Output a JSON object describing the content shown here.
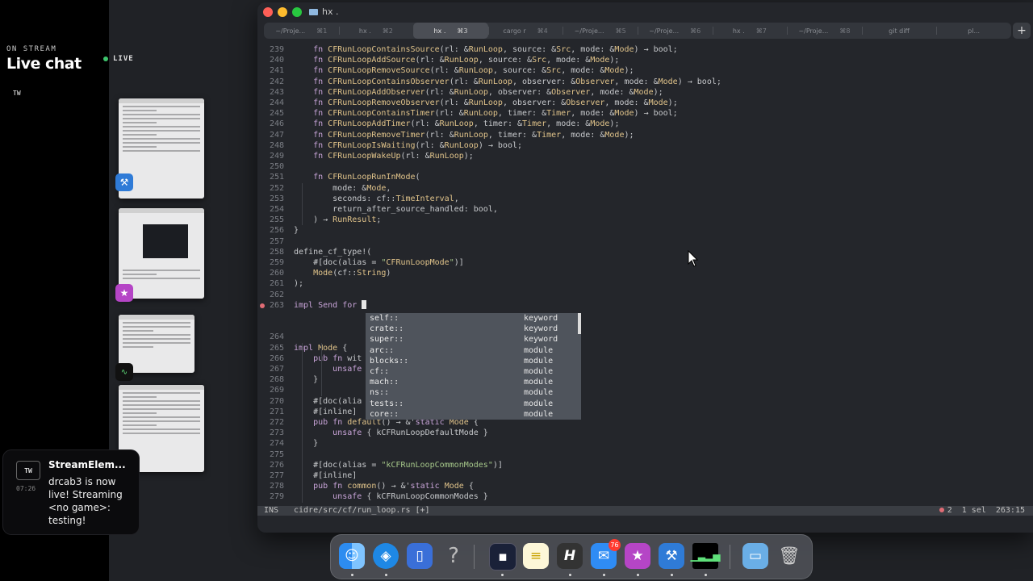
{
  "chat": {
    "on_stream_label": "ON STREAM",
    "title": "Live chat",
    "platform_tag": "TW",
    "live_label": "LIVE"
  },
  "notification": {
    "platform": "TW",
    "time": "07:26",
    "title": "StreamElem...",
    "body": "drcab3 is now live! Streaming <no game>: testing!"
  },
  "window": {
    "title": "hx .",
    "tabs": [
      {
        "label": "~/Proje...",
        "shortcut": "⌘1",
        "active": false
      },
      {
        "label": "hx .",
        "shortcut": "⌘2",
        "active": false
      },
      {
        "label": "hx .",
        "shortcut": "⌘3",
        "active": true
      },
      {
        "label": "cargo r",
        "shortcut": "⌘4",
        "active": false
      },
      {
        "label": "~/Proje...",
        "shortcut": "⌘5",
        "active": false
      },
      {
        "label": "~/Proje...",
        "shortcut": "⌘6",
        "active": false
      },
      {
        "label": "hx .",
        "shortcut": "⌘7",
        "active": false
      },
      {
        "label": "~/Proje...",
        "shortcut": "⌘8",
        "active": false
      },
      {
        "label": "git diff",
        "shortcut": "",
        "active": false
      },
      {
        "label": "pl...",
        "shortcut": "",
        "active": false
      }
    ],
    "new_tab_label": "+"
  },
  "editor": {
    "lines": [
      {
        "n": "239",
        "text": "    fn CFRunLoopContainsSource(rl: &RunLoop, source: &Src, mode: &Mode) → bool;"
      },
      {
        "n": "240",
        "text": "    fn CFRunLoopAddSource(rl: &RunLoop, source: &Src, mode: &Mode);"
      },
      {
        "n": "241",
        "text": "    fn CFRunLoopRemoveSource(rl: &RunLoop, source: &Src, mode: &Mode);"
      },
      {
        "n": "242",
        "text": "    fn CFRunLoopContainsObserver(rl: &RunLoop, observer: &Observer, mode: &Mode) → bool;"
      },
      {
        "n": "243",
        "text": "    fn CFRunLoopAddObserver(rl: &RunLoop, observer: &Observer, mode: &Mode);"
      },
      {
        "n": "244",
        "text": "    fn CFRunLoopRemoveObserver(rl: &RunLoop, observer: &Observer, mode: &Mode);"
      },
      {
        "n": "245",
        "text": "    fn CFRunLoopContainsTimer(rl: &RunLoop, timer: &Timer, mode: &Mode) → bool;"
      },
      {
        "n": "246",
        "text": "    fn CFRunLoopAddTimer(rl: &RunLoop, timer: &Timer, mode: &Mode);"
      },
      {
        "n": "247",
        "text": "    fn CFRunLoopRemoveTimer(rl: &RunLoop, timer: &Timer, mode: &Mode);"
      },
      {
        "n": "248",
        "text": "    fn CFRunLoopIsWaiting(rl: &RunLoop) → bool;"
      },
      {
        "n": "249",
        "text": "    fn CFRunLoopWakeUp(rl: &RunLoop);"
      },
      {
        "n": "250",
        "text": ""
      },
      {
        "n": "251",
        "text": "    fn CFRunLoopRunInMode("
      },
      {
        "n": "252",
        "text": "        mode: &Mode,"
      },
      {
        "n": "253",
        "text": "        seconds: cf::TimeInterval,"
      },
      {
        "n": "254",
        "text": "        return_after_source_handled: bool,"
      },
      {
        "n": "255",
        "text": "    ) → RunResult;"
      },
      {
        "n": "256",
        "text": "}"
      },
      {
        "n": "257",
        "text": ""
      },
      {
        "n": "258",
        "text": "define_cf_type!("
      },
      {
        "n": "259",
        "text": "    #[doc(alias = \"CFRunLoopMode\")]"
      },
      {
        "n": "260",
        "text": "    Mode(cf::String)"
      },
      {
        "n": "261",
        "text": ");"
      },
      {
        "n": "262",
        "text": ""
      },
      {
        "n": "263",
        "text": "impl Send for "
      },
      {
        "n": "",
        "text": ""
      },
      {
        "n": "",
        "text": ""
      },
      {
        "n": "264",
        "text": ""
      },
      {
        "n": "265",
        "text": "impl Mode {"
      },
      {
        "n": "266",
        "text": "    pub fn wit"
      },
      {
        "n": "267",
        "text": "        unsafe"
      },
      {
        "n": "268",
        "text": "    }"
      },
      {
        "n": "269",
        "text": ""
      },
      {
        "n": "270",
        "text": "    #[doc(alia"
      },
      {
        "n": "271",
        "text": "    #[inline]"
      },
      {
        "n": "272",
        "text": "    pub fn default() → &'static Mode {"
      },
      {
        "n": "273",
        "text": "        unsafe { kCFRunLoopDefaultMode }"
      },
      {
        "n": "274",
        "text": "    }"
      },
      {
        "n": "275",
        "text": ""
      },
      {
        "n": "276",
        "text": "    #[doc(alias = \"kCFRunLoopCommonModes\")]"
      },
      {
        "n": "277",
        "text": "    #[inline]"
      },
      {
        "n": "278",
        "text": "    pub fn common() → &'static Mode {"
      },
      {
        "n": "279",
        "text": "        unsafe { kCFRunLoopCommonModes }"
      }
    ],
    "completion": [
      {
        "name": "self::",
        "kind": "keyword"
      },
      {
        "name": "crate::",
        "kind": "keyword"
      },
      {
        "name": "super::",
        "kind": "keyword"
      },
      {
        "name": "arc::",
        "kind": "module"
      },
      {
        "name": "blocks::",
        "kind": "module"
      },
      {
        "name": "cf::",
        "kind": "module"
      },
      {
        "name": "mach::",
        "kind": "module"
      },
      {
        "name": "ns::",
        "kind": "module"
      },
      {
        "name": "tests::",
        "kind": "module"
      },
      {
        "name": "core::",
        "kind": "module"
      }
    ]
  },
  "status": {
    "mode": "INS",
    "file": "cidre/src/cf/run_loop.rs [+]",
    "errors": "2",
    "selection": "1 sel",
    "position": "263:15"
  },
  "dock": {
    "mail_badge": "76",
    "help_glyph": "?"
  },
  "colors": {
    "live_green": "#3ec46d",
    "error_red": "#e06c75",
    "editor_bg": "#24262b",
    "completion_bg": "#4f545c"
  }
}
